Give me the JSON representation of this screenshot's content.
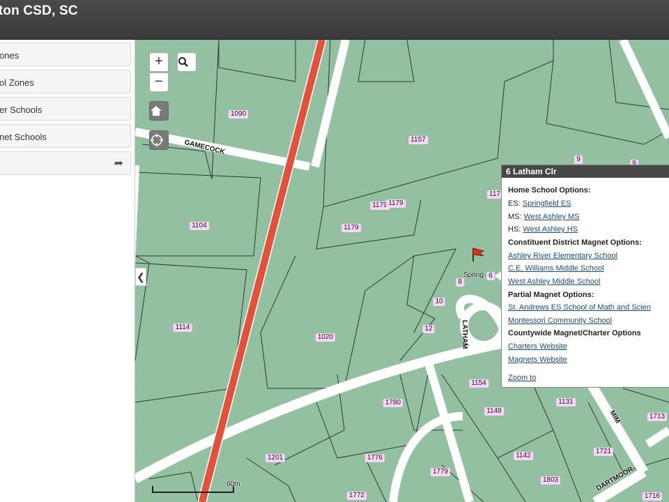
{
  "header": {
    "title": "ston CSD, SC"
  },
  "sidebar": {
    "panels": [
      {
        "label": "ones"
      },
      {
        "label": "ol Zones"
      },
      {
        "label": "er Schools"
      },
      {
        "label": "net Schools"
      },
      {
        "label": ""
      }
    ]
  },
  "map": {
    "parcels": [
      "1090",
      "1157",
      "1104",
      "1179",
      "1179",
      "1179",
      "1114",
      "1020",
      "10",
      "12",
      "8",
      "6",
      "1154",
      "1131",
      "1148",
      "1780",
      "1776",
      "1201",
      "1779",
      "1142",
      "1803",
      "1721",
      "1713",
      "1772",
      "1716",
      "117",
      "9",
      "9"
    ],
    "streets": {
      "gamecock": "GAMECOCK",
      "latham": "LATHAM",
      "mim": "MIM",
      "dartmoor": "DARTMOOR",
      "spring": "Spring"
    },
    "scale": {
      "label": "60m"
    }
  },
  "popup": {
    "title": "6 Latham Clr",
    "home_header": "Home School Options:",
    "es_prefix": "ES:",
    "es_link": "Springfield ES",
    "ms_prefix": "MS:",
    "ms_link": "West Ashley MS",
    "hs_prefix": "HS:",
    "hs_link": "West Ashley HS",
    "constituent_header": "Constituent District Magnet Options:",
    "constituent_links": [
      "Ashley River Elementary School",
      "C.E. Williams Middle School",
      "West Ashley Middle School"
    ],
    "partial_header": "Partial Magnet Options:",
    "partial_links": [
      "St. Andrews ES School of Math and Scien",
      "Montessori Community School"
    ],
    "countywide_header": "Countywide Magnet/Charter Options",
    "countywide_links": [
      "Charters Website",
      "Magnets Website"
    ],
    "zoom_link": "Zoom to"
  },
  "colors": {
    "parcel_fill": "#92c0a1",
    "road": "#ffffff",
    "highway": "#e2513a",
    "label_bg": "#f6d5f6"
  },
  "icons": {
    "zoom_in": "plus-icon",
    "zoom_out": "minus-icon",
    "search": "search-icon",
    "home": "home-icon",
    "locate": "locate-icon",
    "marker": "flag-icon",
    "collapse": "chevron-left-icon",
    "share": "share-arrow-icon"
  }
}
